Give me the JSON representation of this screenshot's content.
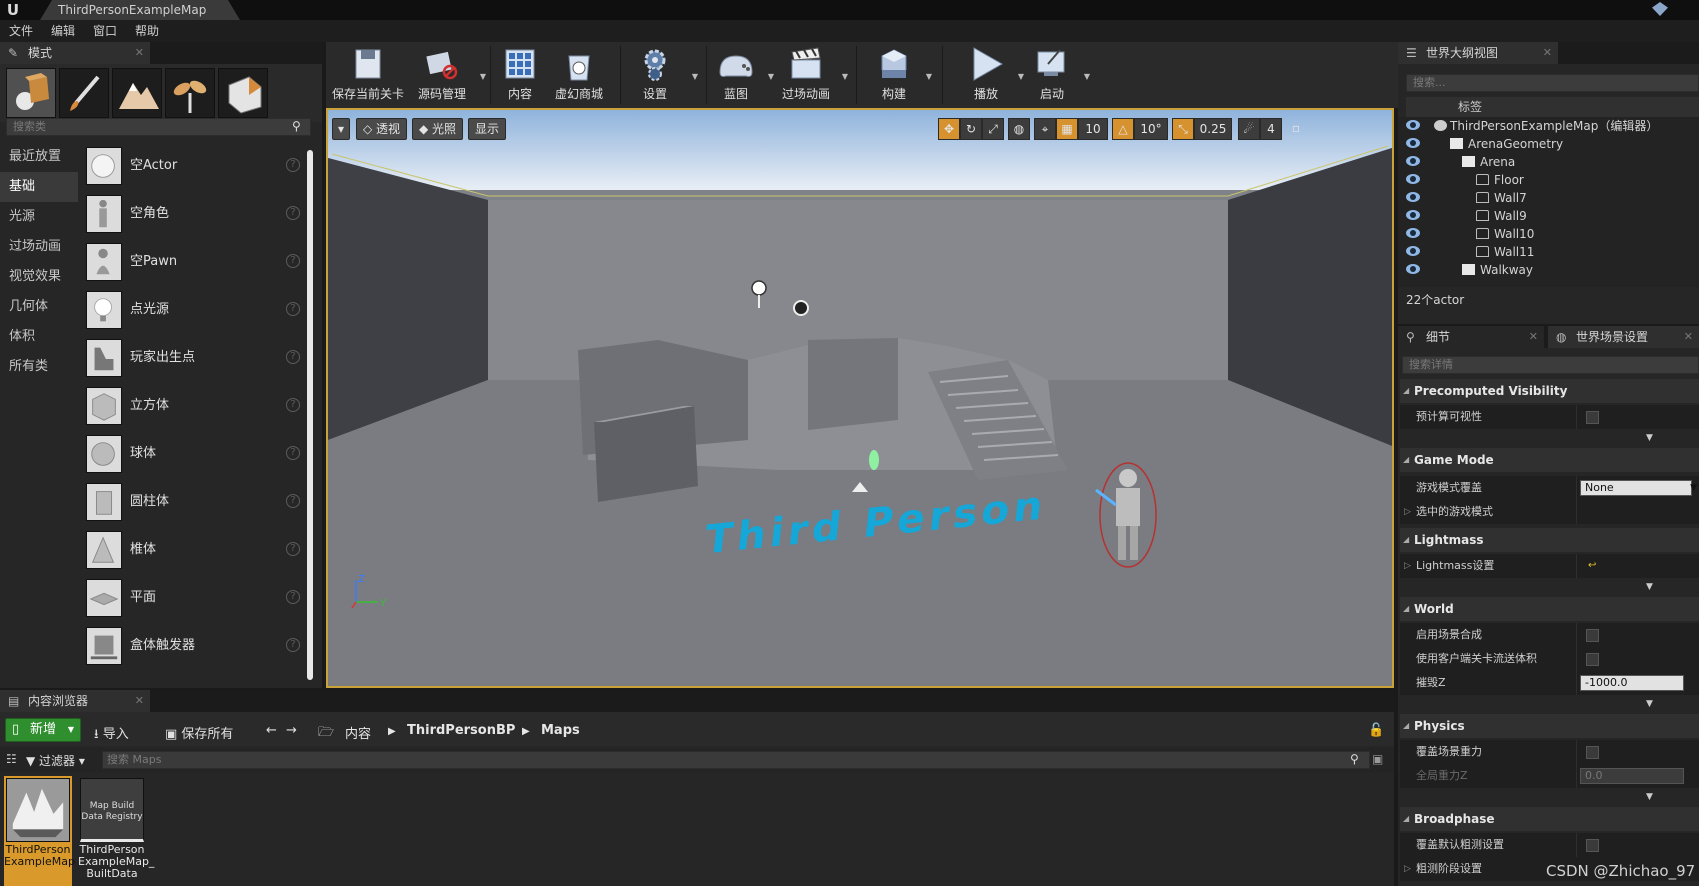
{
  "window": {
    "map_tab": "ThirdPersonExampleMap"
  },
  "menu": [
    "文件",
    "编辑",
    "窗口",
    "帮助"
  ],
  "modes_panel": {
    "tab": "模式",
    "mode_icons": [
      "place-mode-icon",
      "paint-mode-icon",
      "landscape-mode-icon",
      "foliage-mode-icon",
      "geometry-mode-icon"
    ],
    "search_placeholder": "搜索类",
    "categories": [
      "最近放置",
      "基础",
      "光源",
      "过场动画",
      "视觉效果",
      "几何体",
      "体积",
      "所有类"
    ],
    "active_category": 1,
    "actors": [
      {
        "label": "空Actor",
        "icon": "empty-actor-icon"
      },
      {
        "label": "空角色",
        "icon": "empty-character-icon"
      },
      {
        "label": "空Pawn",
        "icon": "empty-pawn-icon"
      },
      {
        "label": "点光源",
        "icon": "point-light-icon"
      },
      {
        "label": "玩家出生点",
        "icon": "player-start-icon"
      },
      {
        "label": "立方体",
        "icon": "cube-icon"
      },
      {
        "label": "球体",
        "icon": "sphere-icon"
      },
      {
        "label": "圆柱体",
        "icon": "cylinder-icon"
      },
      {
        "label": "椎体",
        "icon": "cone-icon"
      },
      {
        "label": "平面",
        "icon": "plane-icon"
      },
      {
        "label": "盒体触发器",
        "icon": "box-trigger-icon"
      }
    ]
  },
  "toolbar": [
    {
      "label": "保存当前关卡",
      "icon": "save-icon",
      "dropdown": false
    },
    {
      "label": "源码管理",
      "icon": "source-control-icon",
      "dropdown": true
    },
    {
      "label": "内容",
      "icon": "content-icon",
      "dropdown": false
    },
    {
      "label": "虚幻商城",
      "icon": "marketplace-icon",
      "dropdown": false
    },
    {
      "label": "设置",
      "icon": "settings-icon",
      "dropdown": true
    },
    {
      "label": "蓝图",
      "icon": "blueprint-icon",
      "dropdown": true
    },
    {
      "label": "过场动画",
      "icon": "cinematics-icon",
      "dropdown": true
    },
    {
      "label": "构建",
      "icon": "build-icon",
      "dropdown": true
    },
    {
      "label": "播放",
      "icon": "play-icon",
      "dropdown": true
    },
    {
      "label": "启动",
      "icon": "launch-icon",
      "dropdown": true
    }
  ],
  "viewport": {
    "perspective": "透视",
    "lit": "光照",
    "show": "显示",
    "grid_snap": "10",
    "rotation_snap": "10°",
    "scale_snap": "0.25",
    "camera_speed": "4",
    "floor_text": "Third Person",
    "colors": {
      "border": "#c9a33a",
      "floor_text": "#14a7d8"
    }
  },
  "outliner": {
    "tab": "世界大纲视图",
    "search_placeholder": "搜索...",
    "column": "标签",
    "rows": [
      {
        "label": "ThirdPersonExampleMap（编辑器）",
        "depth": 0,
        "icon": "world-icon"
      },
      {
        "label": "ArenaGeometry",
        "depth": 1,
        "icon": "folder-icon"
      },
      {
        "label": "Arena",
        "depth": 2,
        "icon": "folder-icon"
      },
      {
        "label": "Floor",
        "depth": 3,
        "icon": "static-mesh-icon"
      },
      {
        "label": "Wall7",
        "depth": 3,
        "icon": "static-mesh-icon"
      },
      {
        "label": "Wall9",
        "depth": 3,
        "icon": "static-mesh-icon"
      },
      {
        "label": "Wall10",
        "depth": 3,
        "icon": "static-mesh-icon"
      },
      {
        "label": "Wall11",
        "depth": 3,
        "icon": "static-mesh-icon"
      },
      {
        "label": "Walkway",
        "depth": 2,
        "icon": "folder-icon"
      }
    ],
    "actor_count": "22个actor"
  },
  "details": {
    "tab_details": "细节",
    "tab_world": "世界场景设置",
    "search_placeholder": "搜索详情",
    "sections": [
      {
        "title": "Precomputed Visibility",
        "props": [
          {
            "label": "预计算可视性",
            "type": "check"
          }
        ]
      },
      {
        "title": "Game Mode",
        "props": [
          {
            "label": "游戏模式覆盖",
            "type": "select",
            "value": "None"
          },
          {
            "label": "选中的游戏模式",
            "type": "expander"
          }
        ]
      },
      {
        "title": "Lightmass",
        "props": [
          {
            "label": "Lightmass设置",
            "type": "expander"
          }
        ]
      },
      {
        "title": "World",
        "props": [
          {
            "label": "启用场景合成",
            "type": "check"
          },
          {
            "label": "使用客户端关卡流送体积",
            "type": "check"
          },
          {
            "label": "摧毁Z",
            "type": "number",
            "value": "-1000.0"
          }
        ]
      },
      {
        "title": "Physics",
        "props": [
          {
            "label": "覆盖场景重力",
            "type": "check"
          },
          {
            "label": "全局重力Z",
            "type": "number",
            "value": "0.0",
            "disabled": true
          }
        ]
      },
      {
        "title": "Broadphase",
        "props": [
          {
            "label": "覆盖默认粗测设置",
            "type": "check"
          },
          {
            "label": "粗测阶段设置",
            "type": "expander"
          }
        ]
      }
    ]
  },
  "content_browser": {
    "tab": "内容浏览器",
    "new": "新增",
    "import": "导入",
    "save_all": "保存所有",
    "path": [
      "内容",
      "ThirdPersonBP",
      "Maps"
    ],
    "filters": "过滤器",
    "search_placeholder": "搜索 Maps",
    "assets": [
      {
        "name": "ThirdPerson ExampleMap",
        "selected": true,
        "thumb_text": ""
      },
      {
        "name": "ThirdPerson ExampleMap_ BuiltData",
        "selected": false,
        "thumb_text": "Map Build Data Registry"
      }
    ]
  },
  "watermark": "CSDN @Zhichao_97"
}
